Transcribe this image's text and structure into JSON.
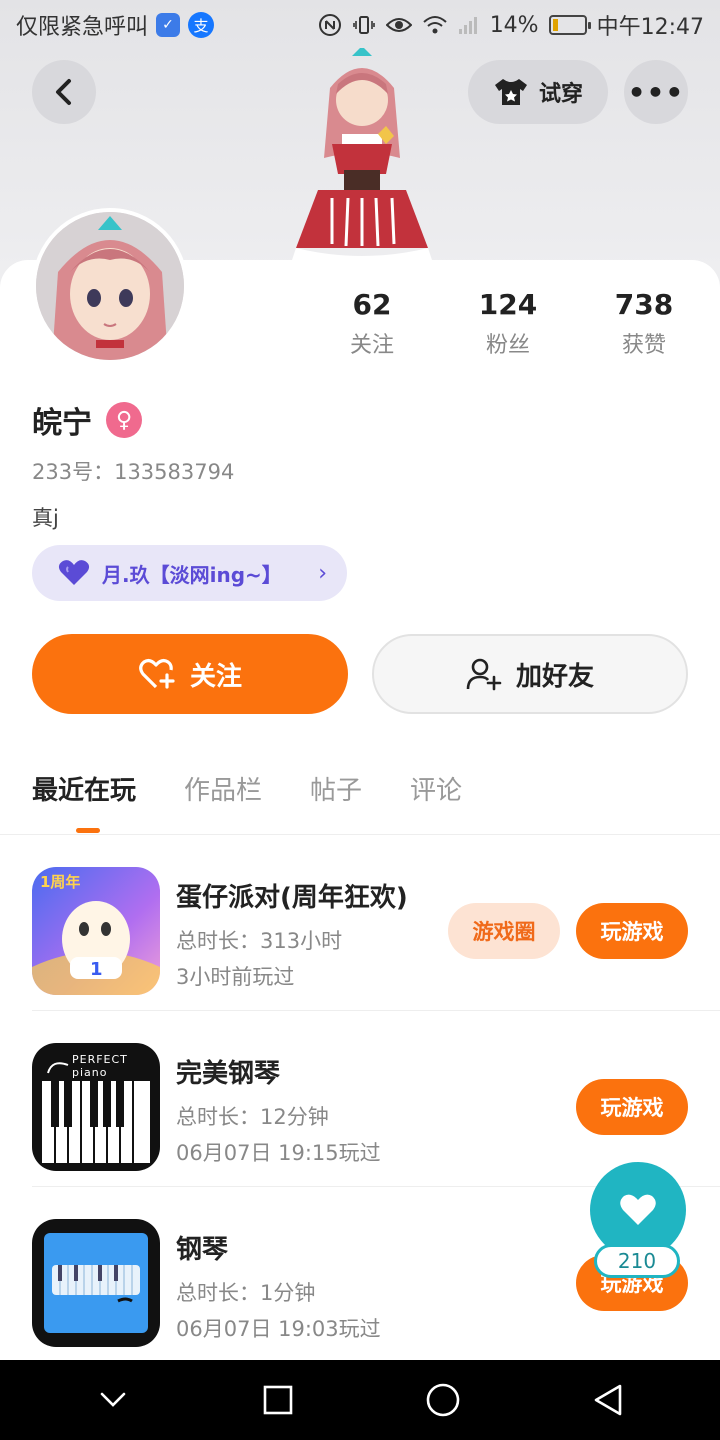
{
  "status_bar": {
    "carrier_text": "仅限紧急呼叫",
    "battery_percent": "14%",
    "time": "中午12:47"
  },
  "header": {
    "try_on_label": "试穿",
    "more_label": "•••"
  },
  "profile": {
    "name": "皖宁",
    "uid": "233号：133583794",
    "bio": "真j",
    "guild_label": "月.玖【淡网ing~】",
    "stats": [
      {
        "value": "62",
        "label": "关注"
      },
      {
        "value": "124",
        "label": "粉丝"
      },
      {
        "value": "738",
        "label": "获赞"
      }
    ]
  },
  "actions": {
    "follow_label": "关注",
    "add_friend_label": "加好友"
  },
  "tabs": [
    {
      "label": "最近在玩",
      "active": true
    },
    {
      "label": "作品栏",
      "active": false
    },
    {
      "label": "帖子",
      "active": false
    },
    {
      "label": "评论",
      "active": false
    }
  ],
  "games": [
    {
      "title": "蛋仔派对(周年狂欢)",
      "total_time": "总时长：313小时",
      "last_played": "3小时前玩过",
      "circle_label": "游戏圈",
      "play_label": "玩游戏",
      "icon_badge": "1周年"
    },
    {
      "title": "完美钢琴",
      "total_time": "总时长：12分钟",
      "last_played": "06月07日 19:15玩过",
      "play_label": "玩游戏",
      "icon_badge": "PERFECT piano"
    },
    {
      "title": "钢琴",
      "total_time": "总时长：1分钟",
      "last_played": "06月07日 19:03玩过",
      "play_label": "玩游戏"
    }
  ],
  "fab": {
    "count": "210"
  },
  "colors": {
    "accent": "#fb720e",
    "fab": "#20b5c2",
    "guild": "#5b4bd6",
    "gender": "#f06a8e"
  }
}
